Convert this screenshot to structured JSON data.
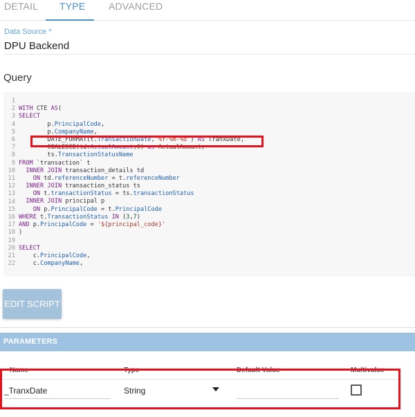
{
  "tabs": [
    {
      "label": "DETAIL"
    },
    {
      "label": "TYPE"
    },
    {
      "label": "ADVANCED"
    }
  ],
  "data_source": {
    "label": "Data Source",
    "required_mark": "*",
    "value": "DPU Backend"
  },
  "query": {
    "label": "Query",
    "line_numbers": "1\n2\n3\n4\n5\n6\n7\n8\n9\n10\n11\n12\n13\n14\n15\n16\n17\n18\n19\n20\n21\n22",
    "lines": [
      "",
      "WITH CTE AS(",
      "SELECT",
      "        p.PrincipalCode,",
      "        p.CompanyName,",
      "        DATE_FORMAT(t.TransactionDate,'%Y-%m-%d') AS TranxDate,",
      "        COALESCE(td.ActualAmount,0) as ActualAmount,",
      "        ts.TransactionStatusName",
      "FROM `transaction` t",
      "  INNER JOIN transaction_details td",
      "    ON td.referenceNumber = t.referenceNumber",
      "  INNER JOIN transaction_status ts",
      "    ON t.transactionStatus = ts.transactionStatus",
      "  INNER JOIN principal p",
      "    ON p.PrincipalCode = t.PrincipalCode",
      "WHERE t.TransactionStatus IN (3,7)",
      "AND p.PrincipalCode = '${principal_code}'",
      ")",
      "",
      "SELECT",
      "    c.PrincipalCode,",
      "    c.CompanyName,"
    ]
  },
  "edit_script_label": "EDIT SCRIPT",
  "parameters": {
    "title": "PARAMETERS",
    "columns": {
      "name": "Name",
      "type": "Type",
      "default_value": "Default Value",
      "multivalue": "Multivalue"
    },
    "rows": [
      {
        "name": "_TranxDate",
        "type": "String",
        "default_value": "",
        "multivalue": false
      }
    ]
  },
  "colors": {
    "accent": "#4a90c8",
    "highlight_box": "#e8101a",
    "params_bar": "#9ec3e2",
    "button": "#a5c2dc"
  }
}
